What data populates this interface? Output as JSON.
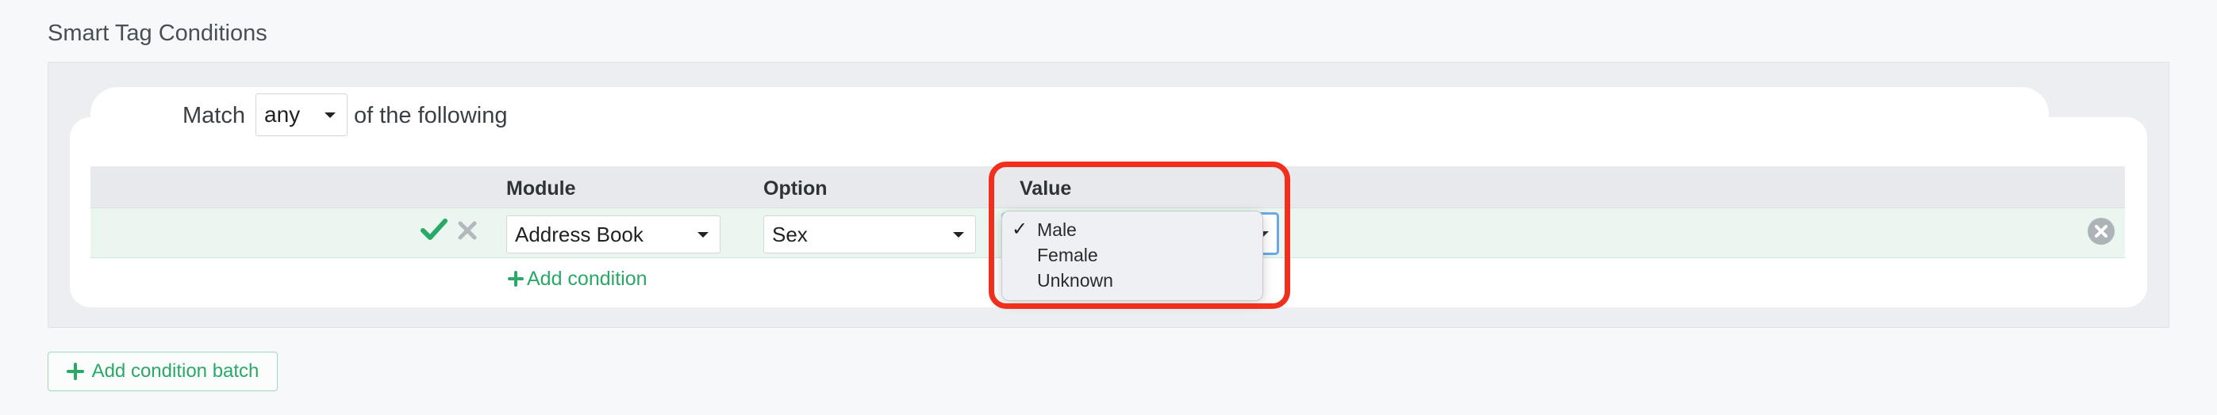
{
  "section": {
    "title": "Smart Tag Conditions"
  },
  "match": {
    "prefix": "Match",
    "mode": "any",
    "suffix": "of the following"
  },
  "table": {
    "headers": {
      "module": "Module",
      "option": "Option",
      "value": "Value"
    }
  },
  "condition": {
    "module": "Address Book",
    "option": "Sex",
    "value": "Male"
  },
  "value_dropdown": {
    "options": [
      "Male",
      "Female",
      "Unknown"
    ],
    "selected": "Male"
  },
  "actions": {
    "add_condition": "Add condition",
    "add_condition_batch": "Add condition batch"
  },
  "colors": {
    "accent_green": "#2aa867",
    "highlight_red": "#f0301c",
    "focus_blue": "#6aa8e8"
  }
}
